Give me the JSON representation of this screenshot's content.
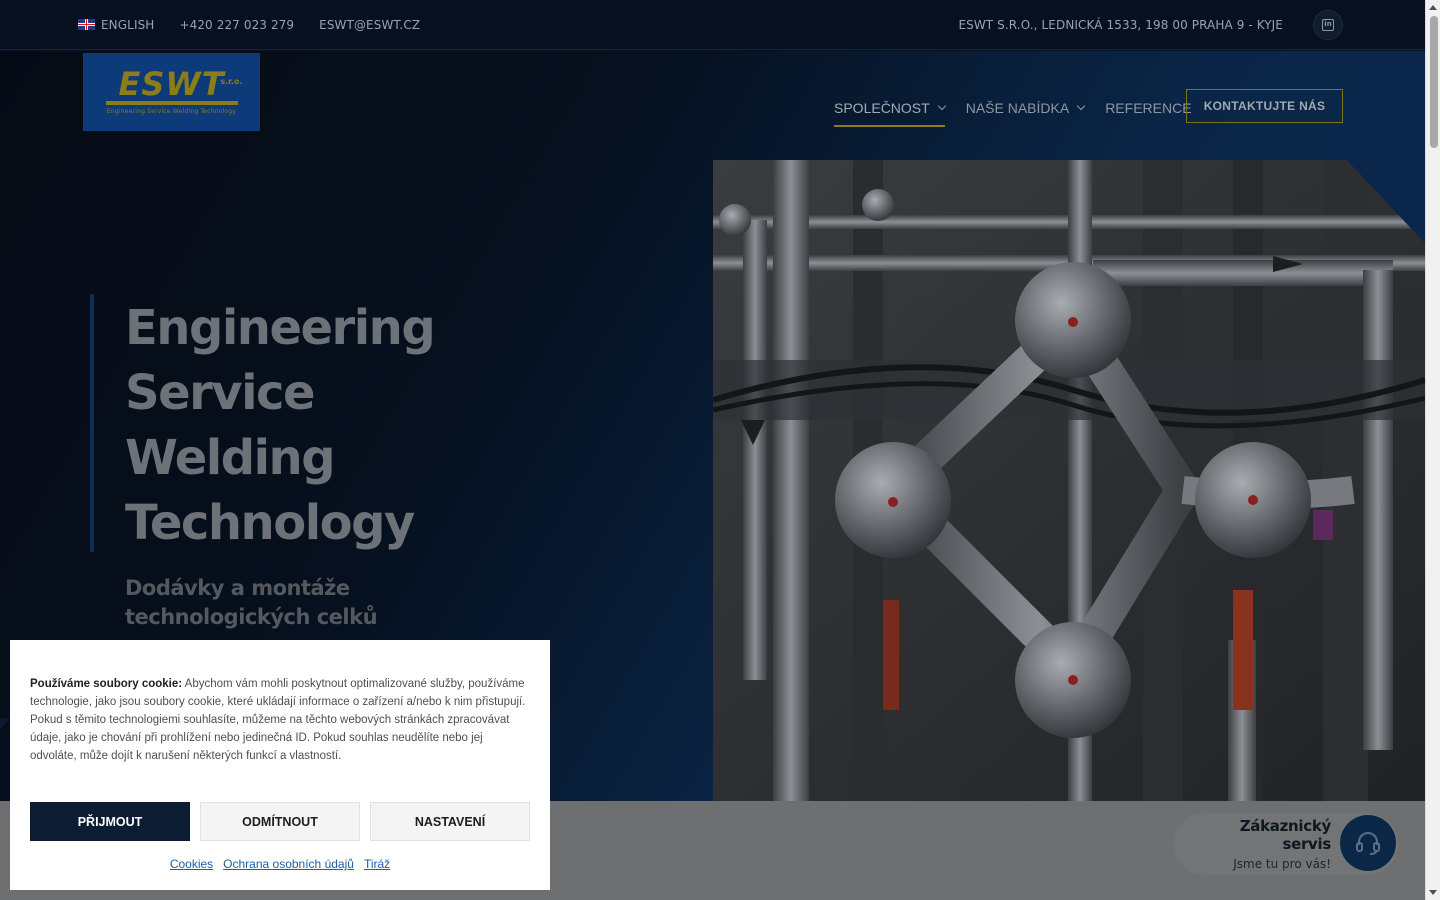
{
  "topbar": {
    "language": "ENGLISH",
    "phone": "+420 227 023 279",
    "email": "ESWT@ESWT.CZ",
    "address": "ESWT S.R.O., LEDNICKÁ 1533, 198 00 PRAHA 9 - KYJE",
    "social_icon": "linkedin-icon"
  },
  "logo": {
    "mark": "ESWT",
    "suffix": "s.r.o.",
    "tagline": "Engineering Service Welding Technology"
  },
  "nav": {
    "items": [
      {
        "label": "SPOLEČNOST",
        "has_dropdown": true,
        "active": true
      },
      {
        "label": "NAŠE NABÍDKA",
        "has_dropdown": true,
        "active": false
      },
      {
        "label": "REFERENCE",
        "has_dropdown": false,
        "active": false
      }
    ],
    "cta": "KONTAKTUJTE NÁS"
  },
  "hero": {
    "title_lines": [
      "Engineering",
      "Service",
      "Welding",
      "Technology"
    ],
    "subtitle_lines": [
      "Dodávky a montáže",
      "technologických celků"
    ]
  },
  "cookie": {
    "lead": "Používáme soubory cookie:",
    "body": " Abychom vám mohli poskytnout optimalizované služby, používáme technologie, jako jsou soubory cookie, které ukládají informace o zařízení a/nebo k nim přistupují. Pokud s těmito technologiemi souhlasíte, můžeme na těchto webových stránkách zpracovávat údaje, jako je chování při prohlížení nebo jedinečná ID. Pokud souhlas neudělíte nebo jej odvoláte, může dojít k narušení některých funkcí a vlastností.",
    "accept": "PŘIJMOUT",
    "reject": "ODMÍTNOUT",
    "settings": "NASTAVENÍ",
    "links": [
      "Cookies",
      "Ochrana osobních údajů",
      "Tiráž"
    ]
  },
  "customer_service": {
    "title": "Zákaznický servis",
    "subtitle": "Jsme tu pro vás!",
    "icon": "headset-icon"
  },
  "colors": {
    "brand_gold": "#8c7d1a",
    "brand_blue": "#0d3a78",
    "dark_navy": "#0c1d33",
    "link_blue": "#1b5fa5"
  }
}
